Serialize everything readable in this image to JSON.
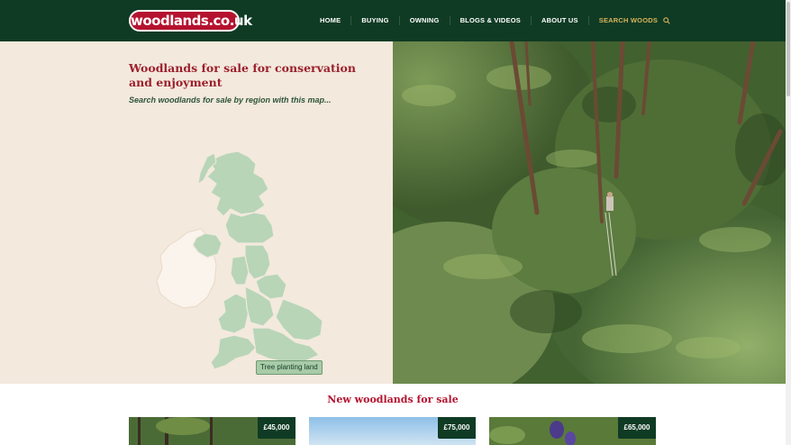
{
  "header": {
    "logo_text": "woodlands.co.uk",
    "nav": [
      {
        "label": "HOME"
      },
      {
        "label": "BUYING"
      },
      {
        "label": "OWNING"
      },
      {
        "label": "BLOGS & VIDEOS"
      },
      {
        "label": "ABOUT US"
      },
      {
        "label": "SEARCH WOODS",
        "icon": "search-icon"
      }
    ]
  },
  "hero": {
    "title": "Woodlands for sale for conservation and enjoyment",
    "subtitle": "Search woodlands for sale by region with this map...",
    "map_badge": "Tree planting land"
  },
  "listings": {
    "title": "New woodlands for sale",
    "cards": [
      {
        "price": "£45,000"
      },
      {
        "price": "£75,000"
      },
      {
        "price": "£65,000"
      }
    ]
  },
  "colors": {
    "header_bg": "#0f3b24",
    "brand_red": "#b5122f",
    "map_fill": "#b8d5b8",
    "hero_bg": "#f3e9dd"
  }
}
